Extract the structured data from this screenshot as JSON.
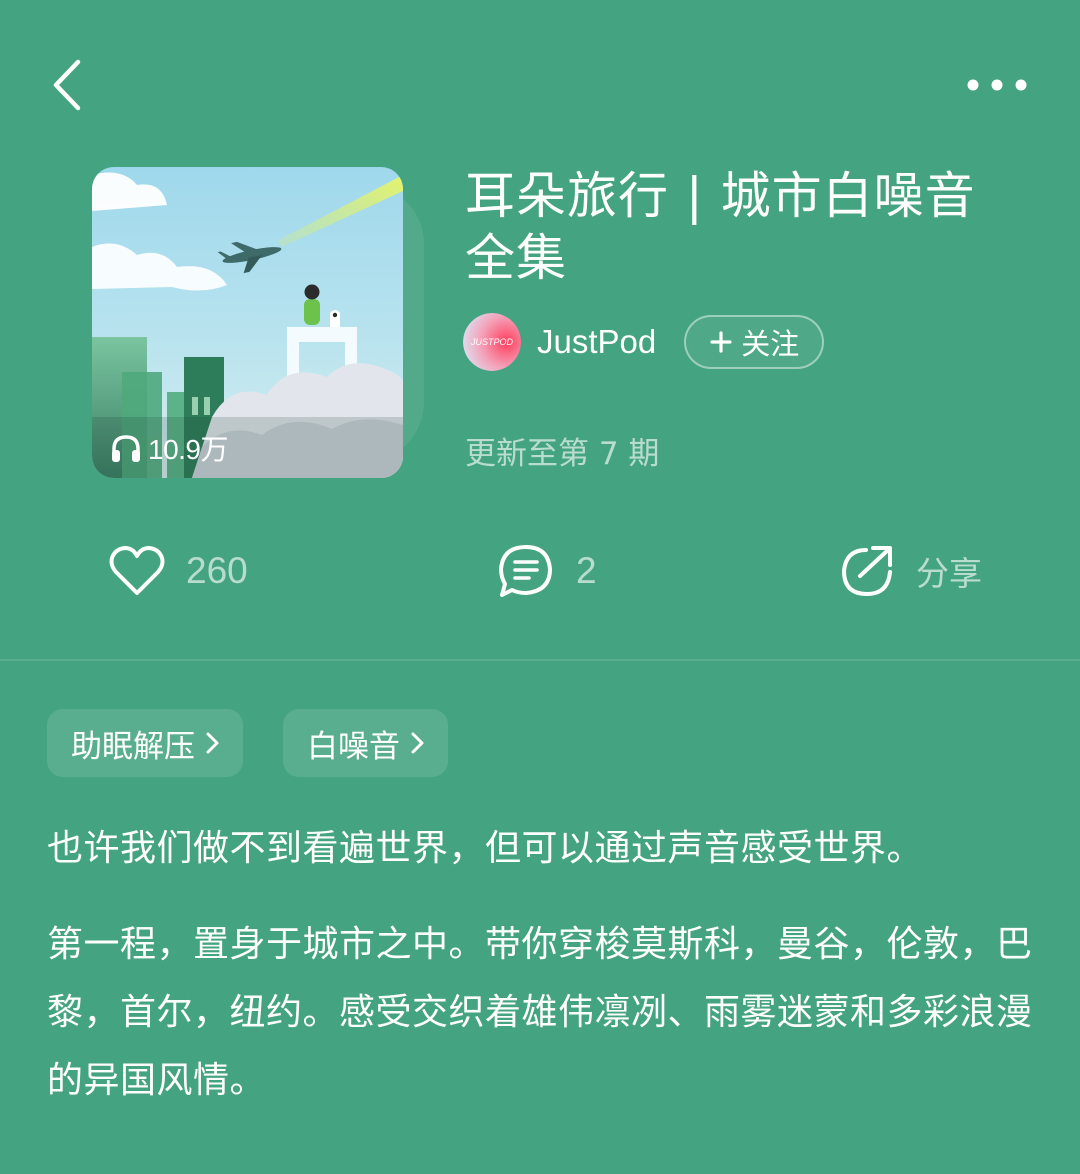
{
  "nav": {
    "back_icon": "chevron-left-icon",
    "more_icon": "more-horizontal-icon"
  },
  "album": {
    "title": "耳朵旅行 | 城市白噪音全集",
    "play_count": "10.9万",
    "author": "JustPod",
    "avatar_text": "JUSTPOD",
    "follow_label": "关注",
    "update_text": "更新至第 7 期"
  },
  "actions": {
    "likes": "260",
    "comments": "2",
    "share_label": "分享"
  },
  "tags": [
    "助眠解压",
    "白噪音"
  ],
  "description": [
    "也许我们做不到看遍世界，但可以通过声音感受世界。",
    "第一程，置身于城市之中。带你穿梭莫斯科，曼谷，伦敦，巴黎，首尔，纽约。感受交织着雄伟凛冽、雨雾迷蒙和多彩浪漫的异国风情。"
  ],
  "colors": {
    "background": "#44a381",
    "text": "#ffffff",
    "muted_text": "rgba(255,255,255,0.62)"
  }
}
